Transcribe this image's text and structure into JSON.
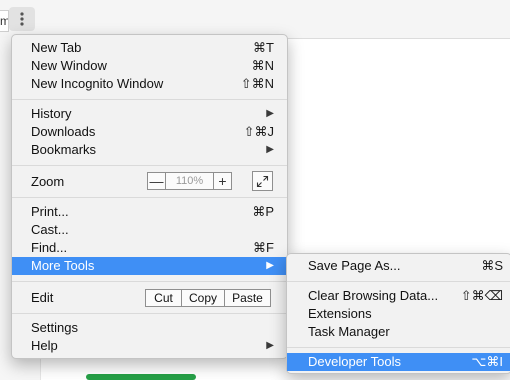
{
  "background": {
    "tab_fragment": "ma"
  },
  "main_menu": {
    "new_tab": {
      "label": "New Tab",
      "shortcut": "⌘T"
    },
    "new_window": {
      "label": "New Window",
      "shortcut": "⌘N"
    },
    "new_incognito": {
      "label": "New Incognito Window",
      "shortcut": "⇧⌘N"
    },
    "history": {
      "label": "History"
    },
    "downloads": {
      "label": "Downloads",
      "shortcut": "⇧⌘J"
    },
    "bookmarks": {
      "label": "Bookmarks"
    },
    "zoom": {
      "label": "Zoom",
      "value": "110%",
      "minus": "—",
      "plus": "+"
    },
    "print": {
      "label": "Print...",
      "shortcut": "⌘P"
    },
    "cast": {
      "label": "Cast..."
    },
    "find": {
      "label": "Find...",
      "shortcut": "⌘F"
    },
    "more_tools": {
      "label": "More Tools"
    },
    "edit": {
      "label": "Edit",
      "cut": "Cut",
      "copy": "Copy",
      "paste": "Paste"
    },
    "settings": {
      "label": "Settings"
    },
    "help": {
      "label": "Help"
    }
  },
  "sub_menu": {
    "save_page": {
      "label": "Save Page As...",
      "shortcut": "⌘S"
    },
    "clear_data": {
      "label": "Clear Browsing Data...",
      "shortcut": "⇧⌘⌫"
    },
    "extensions": {
      "label": "Extensions"
    },
    "task_manager": {
      "label": "Task Manager"
    },
    "dev_tools": {
      "label": "Developer Tools",
      "shortcut": "⌥⌘I"
    }
  },
  "colors": {
    "highlight": "#3f8ff5",
    "menu_bg": "#f2f2f2"
  }
}
